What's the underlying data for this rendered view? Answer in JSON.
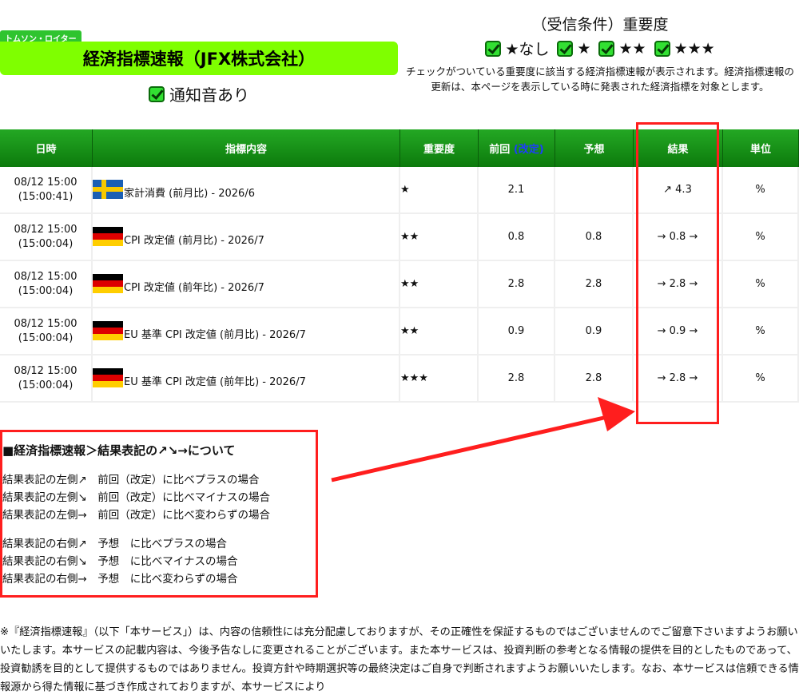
{
  "header": {
    "badge": "トムソン・ロイター",
    "title": "経済指標速報（JFX株式会社）",
    "sound_label": "通知音あり"
  },
  "conditions": {
    "title": "（受信条件）重要度",
    "items": [
      "★なし",
      "★",
      "★★",
      "★★★"
    ],
    "note": "チェックがついている重要度に該当する経済指標速報が表示されます。経済指標速報の更新は、本ページを表示している時に発表された経済指標を対象とします。"
  },
  "table": {
    "headers": {
      "datetime": "日時",
      "indicator": "指標内容",
      "importance": "重要度",
      "prev": "前回",
      "prev_revised": "(改定)",
      "forecast": "予想",
      "result": "結果",
      "unit": "単位"
    },
    "rows": [
      {
        "date": "08/12 15:00",
        "time": "(15:00:41)",
        "flag": "sweden-flag",
        "indicator": "家計消費 (前月比) - 2026/6",
        "importance": "★",
        "prev": "2.1",
        "forecast": "",
        "result": "↗ 4.3",
        "unit": "%"
      },
      {
        "date": "08/12 15:00",
        "time": "(15:00:04)",
        "flag": "germany-flag",
        "indicator": "CPI 改定値 (前月比) - 2026/7",
        "importance": "★★",
        "prev": "0.8",
        "forecast": "0.8",
        "result": "→ 0.8 →",
        "unit": "%"
      },
      {
        "date": "08/12 15:00",
        "time": "(15:00:04)",
        "flag": "germany-flag",
        "indicator": "CPI 改定値 (前年比) - 2026/7",
        "importance": "★★",
        "prev": "2.8",
        "forecast": "2.8",
        "result": "→ 2.8 →",
        "unit": "%"
      },
      {
        "date": "08/12 15:00",
        "time": "(15:00:04)",
        "flag": "germany-flag",
        "indicator": "EU 基準 CPI 改定値 (前月比) - 2026/7",
        "importance": "★★",
        "prev": "0.9",
        "forecast": "0.9",
        "result": "→ 0.9 →",
        "unit": "%"
      },
      {
        "date": "08/12 15:00",
        "time": "(15:00:04)",
        "flag": "germany-flag",
        "indicator": "EU 基準 CPI 改定値 (前年比) - 2026/7",
        "importance": "★★★",
        "prev": "2.8",
        "forecast": "2.8",
        "result": "→ 2.8 →",
        "unit": "%"
      }
    ]
  },
  "legend": {
    "title": "■経済指標速報＞結果表記の↗↘→について",
    "left": [
      "結果表記の左側↗　前回（改定）に比べプラスの場合",
      "結果表記の左側↘　前回（改定）に比べマイナスの場合",
      "結果表記の左側→　前回（改定）に比べ変わらずの場合"
    ],
    "right": [
      "結果表記の右側↗　予想　に比べプラスの場合",
      "結果表記の右側↘　予想　に比べマイナスの場合",
      "結果表記の右側→　予想　に比べ変わらずの場合"
    ]
  },
  "disclaimer": "※『経済指標速報』（以下「本サービス」）は、内容の信頼性には充分配慮しておりますが、その正確性を保証するものではございませんのでご留意下さいますようお願いいたします。本サービスの記載内容は、今後予告なしに変更されることがございます。また本サービスは、投資判断の参考となる情報の提供を目的としたものであって、投資勧誘を目的として提供するものではありません。投資方針や時期選択等の最終決定はご自身で判断されますようお願いいたします。なお、本サービスは信頼できる情報源から得た情報に基づき作成されておりますが、本サービスにより",
  "colors": {
    "title_bar": "#7fff00",
    "header_green": "#1a9a1a",
    "annotation_red": "#ff1e1e"
  }
}
